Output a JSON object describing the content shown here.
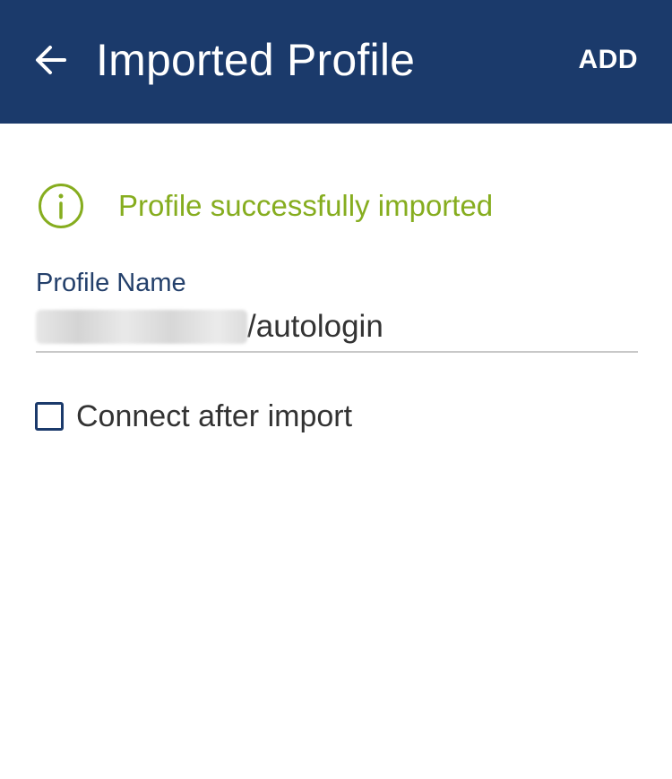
{
  "header": {
    "title": "Imported Profile",
    "back_icon": "arrow-left-icon",
    "action_label": "ADD",
    "background_color": "#1b3a6b",
    "text_color": "#ffffff"
  },
  "status": {
    "icon": "info-circle-icon",
    "message": "Profile successfully imported",
    "color": "#86ad1f"
  },
  "profile_name": {
    "label": "Profile Name",
    "value_suffix": "/autologin",
    "value_prefix_redacted": true
  },
  "options": {
    "connect_after_import": {
      "label": "Connect after import",
      "checked": false
    }
  }
}
